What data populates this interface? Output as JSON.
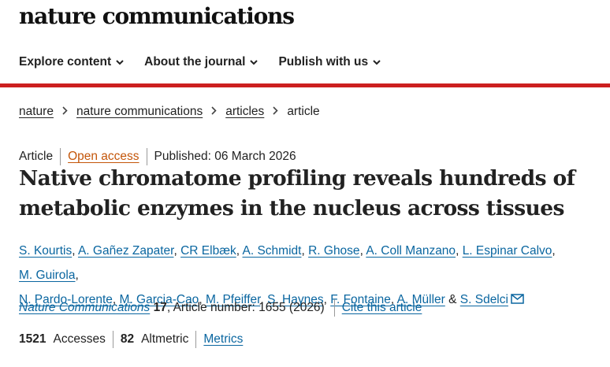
{
  "header": {
    "logo_text": "nature communications"
  },
  "nav": {
    "items": [
      {
        "label": "Explore content"
      },
      {
        "label": "About the journal"
      },
      {
        "label": "Publish with us"
      }
    ]
  },
  "breadcrumb": {
    "items": [
      "nature",
      "nature communications",
      "articles"
    ],
    "current": "article"
  },
  "article": {
    "type": "Article",
    "access": "Open access",
    "published": "Published: 06 March 2026",
    "title_line1": "Native chromatome profiling reveals hundreds of",
    "title_line2": "metabolic enzymes in the nucleus across tissues",
    "authors": [
      "S. Kourtis",
      "A. Gañez Zapater",
      "CR Elbæk",
      "A. Schmidt",
      "R. Ghose",
      "A. Coll Manzano",
      "L. Espinar Calvo",
      "M. Guirola",
      "N. Pardo-Lorente",
      "M. Garcia-Cao",
      "M. Pfeiffer",
      "S. Haynes",
      "F. Fontaine",
      "A. Müller",
      "S. Sdelci"
    ],
    "author_sep": ",",
    "author_and": "&",
    "journal": "Nature Communications",
    "volume": "17",
    "article_number": ", Article number: 1655 (2026)",
    "cite_label": "Cite this article"
  },
  "metrics": {
    "accesses_count": "1521",
    "accesses_label": "Accesses",
    "altmetric_count": "82",
    "altmetric_label": "Altmetric",
    "metrics_link": "Metrics"
  },
  "colors": {
    "accent_red": "#cc1f1f",
    "link_blue": "#0a66a0",
    "open_access_orange": "#c4560a",
    "text": "#222222"
  }
}
